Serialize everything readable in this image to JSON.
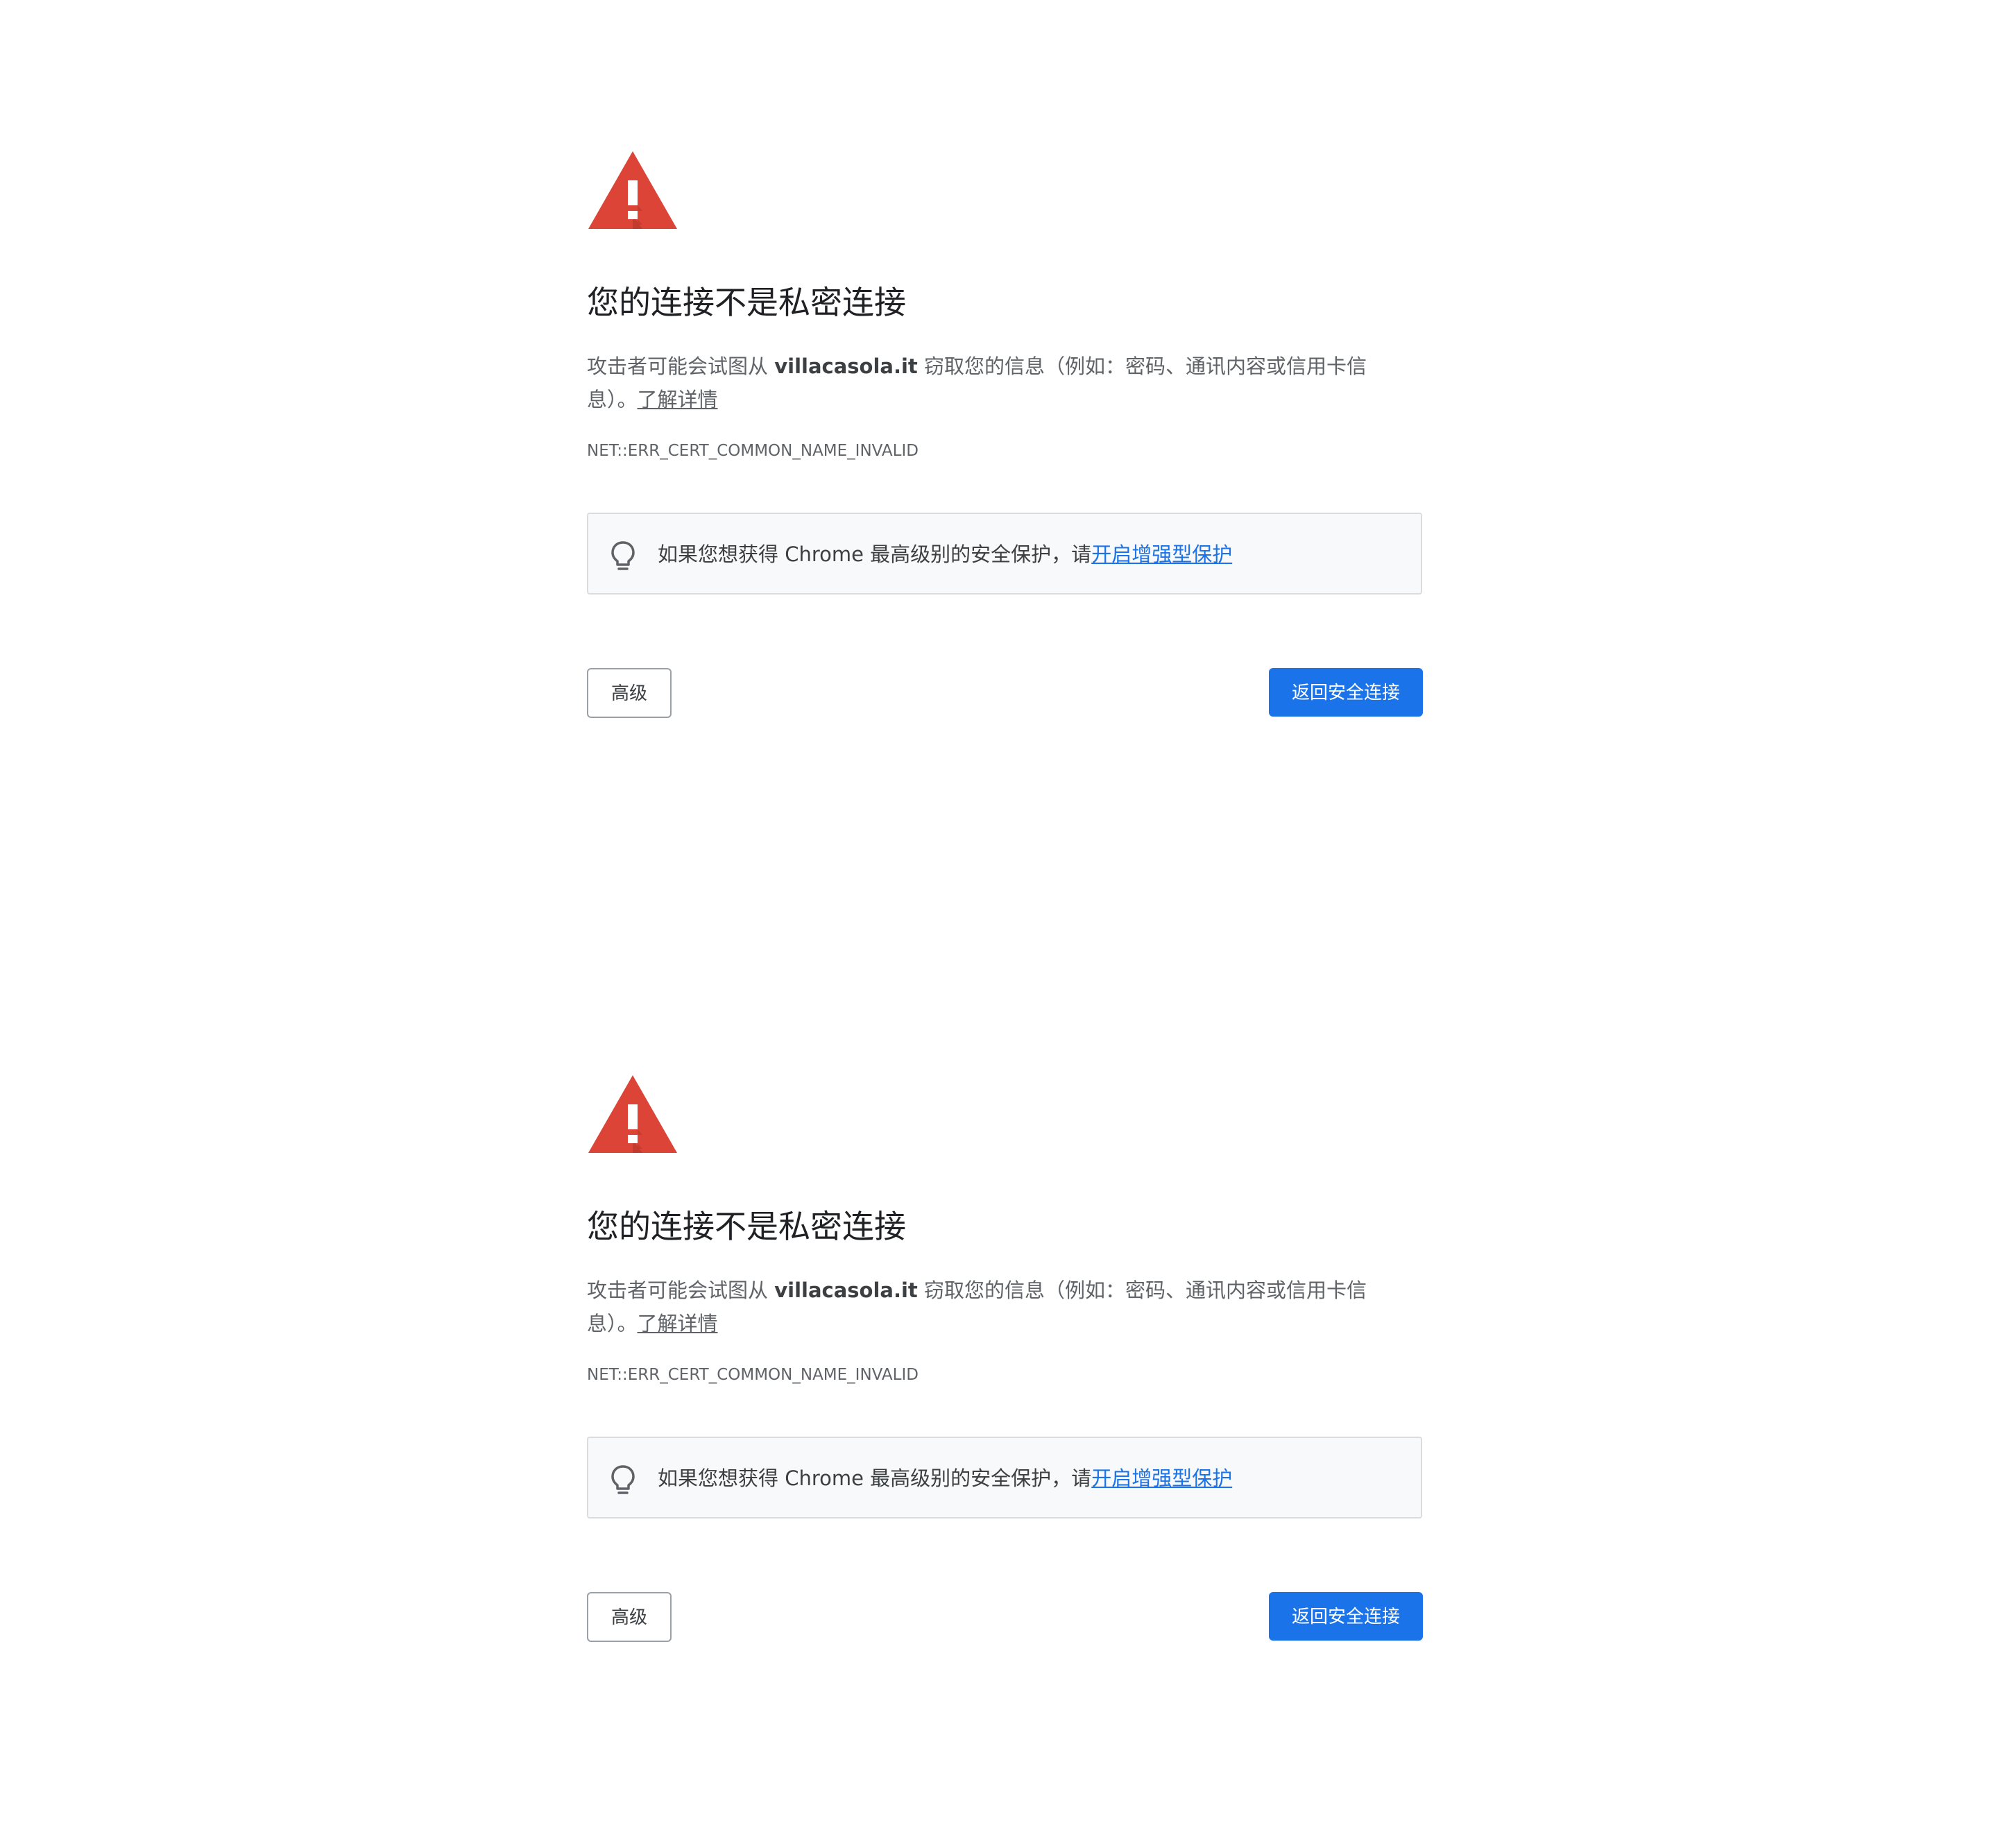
{
  "interstitial": {
    "title": "您的连接不是私密连接",
    "description_prefix": "攻击者可能会试图从 ",
    "hostname": "villacasola.it",
    "description_suffix": " 窃取您的信息（例如：密码、通讯内容或信用卡信息）。",
    "learn_more_link": "了解详情",
    "error_code": "NET::ERR_CERT_COMMON_NAME_INVALID",
    "tip_text": "如果您想获得 Chrome 最高级别的安全保护，请",
    "tip_link": "开启增强型保护",
    "advanced_button": "高级",
    "back_button": "返回安全连接",
    "icons": {
      "warning": "warning-triangle-icon",
      "tip": "lightbulb-icon"
    },
    "colors": {
      "warning_red": "#db4437",
      "primary_blue": "#1a73e8",
      "text_secondary": "#5f6368",
      "tip_background": "#f8f9fa"
    }
  }
}
